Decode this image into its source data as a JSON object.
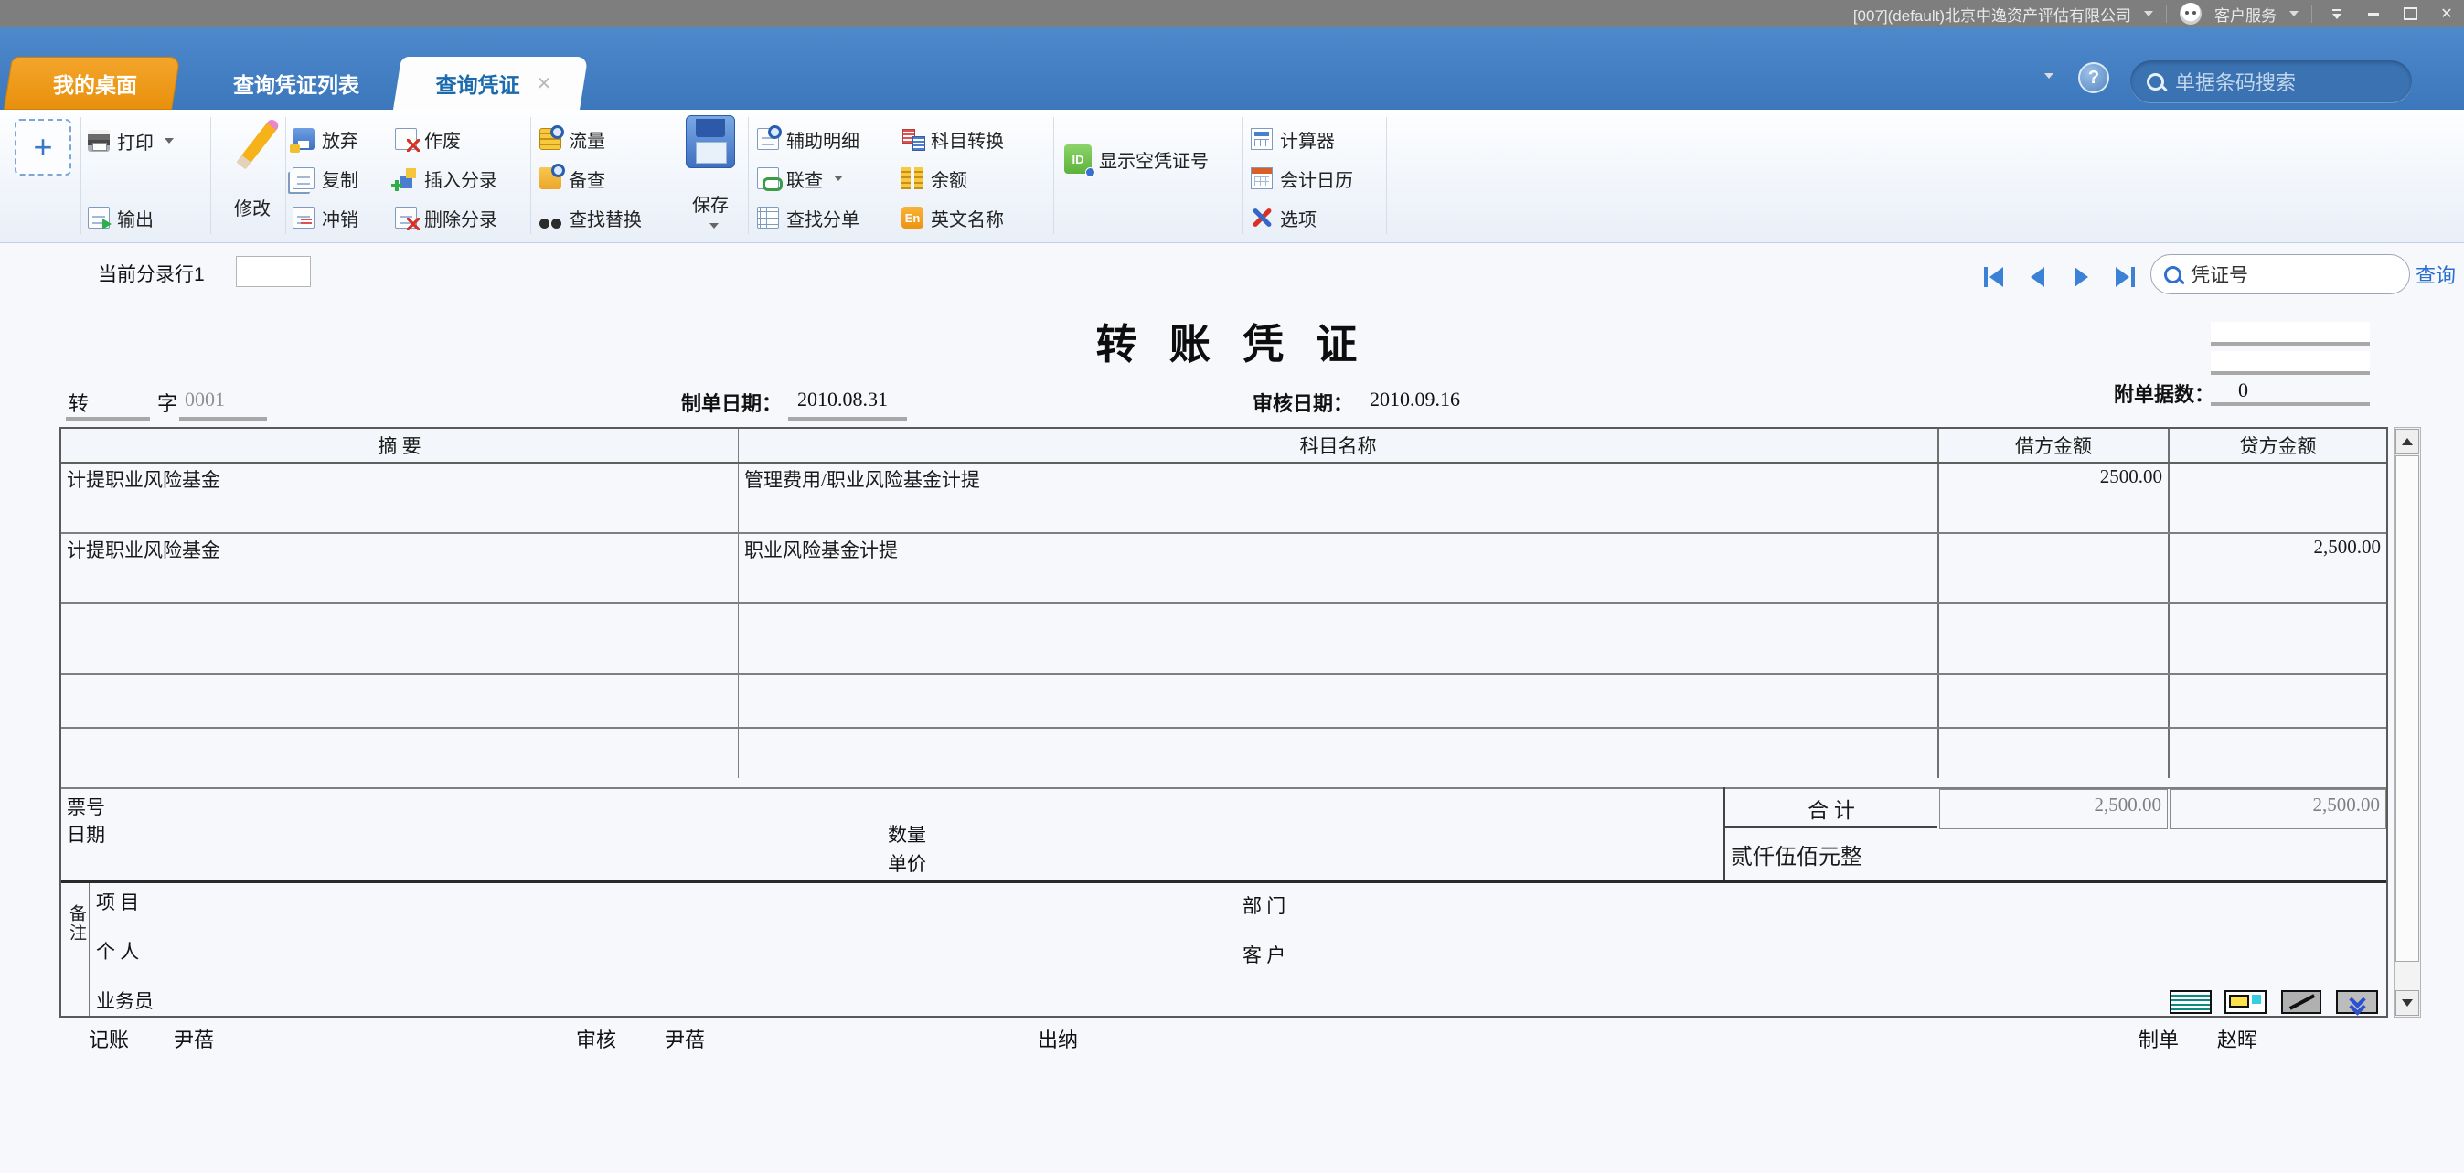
{
  "colors": {
    "accent_blue": "#3d7abf",
    "tab_orange": "#e8900c",
    "titlebar_gray": "#7e7e7e",
    "link_blue": "#2a6fd0",
    "amount_gray": "#808080"
  },
  "icons": {
    "close_glyph": "✕",
    "help_glyph": "?",
    "en_badge": "En",
    "id_badge": "ID"
  },
  "titlebar": {
    "company": "[007](default)北京中逸资产评估有限公司",
    "customer_service": "客户服务"
  },
  "tabbar": {
    "tabs": [
      {
        "label": "我的桌面"
      },
      {
        "label": "查询凭证列表"
      },
      {
        "label": "查询凭证"
      }
    ],
    "search_placeholder": "单据条码搜索"
  },
  "ribbon": {
    "add": "+",
    "print": "打印",
    "export": "输出",
    "modify": "修改",
    "abandon": "放弃",
    "copy": "复制",
    "offset": "冲销",
    "invalidate": "作废",
    "insert_entry": "插入分录",
    "delete_entry": "删除分录",
    "flow": "流量",
    "reference": "备查",
    "find_replace": "查找替换",
    "save": "保存",
    "aux_detail": "辅助明细",
    "linked_query": "联查",
    "find_split": "查找分单",
    "account_convert": "科目转换",
    "balance": "余额",
    "english_name": "英文名称",
    "show_empty_voucher_no": "显示空凭证号",
    "calculator": "计算器",
    "accounting_calendar": "会计日历",
    "options": "选项"
  },
  "entrybar": {
    "current_entry_label": "当前分录行1",
    "entry_value": "",
    "voucher_no_placeholder": "凭证号",
    "query": "查询"
  },
  "voucher": {
    "title": "转 账 凭 证",
    "word_char": "转",
    "word_suffix": "字",
    "word_no": "0001",
    "made_date_label": "制单日期：",
    "made_date": "2010.08.31",
    "audit_date_label": "审核日期：",
    "audit_date": "2010.09.16",
    "attachments_label": "附单据数：",
    "attachments": "0",
    "columns": {
      "summary": "摘 要",
      "account": "科目名称",
      "debit": "借方金额",
      "credit": "贷方金额"
    },
    "rows": [
      {
        "summary": "计提职业风险基金",
        "account": "管理费用/职业风险基金计提",
        "debit": "2500.00",
        "credit": ""
      },
      {
        "summary": "计提职业风险基金",
        "account": "职业风险基金计提",
        "debit": "",
        "credit": "2,500.00"
      },
      {
        "summary": "",
        "account": "",
        "debit": "",
        "credit": ""
      },
      {
        "summary": "",
        "account": "",
        "debit": "",
        "credit": ""
      },
      {
        "summary": "",
        "account": "",
        "debit": "",
        "credit": ""
      }
    ],
    "footer": {
      "ticket": "票号",
      "date": "日期",
      "qty": "数量",
      "price": "单价",
      "total_label": "合 计",
      "total_debit": "2,500.00",
      "total_credit": "2,500.00",
      "amount_words": "贰仟伍佰元整"
    },
    "remark": {
      "label": "备注",
      "project": "项 目",
      "person": "个 人",
      "salesman": "业务员",
      "department": "部 门",
      "customer": "客 户"
    },
    "signatures": {
      "bookkeeper_label": "记账",
      "bookkeeper": "尹蓓",
      "auditor_label": "审核",
      "auditor": "尹蓓",
      "cashier_label": "出纳",
      "maker_label": "制单",
      "maker": "赵晖"
    }
  }
}
